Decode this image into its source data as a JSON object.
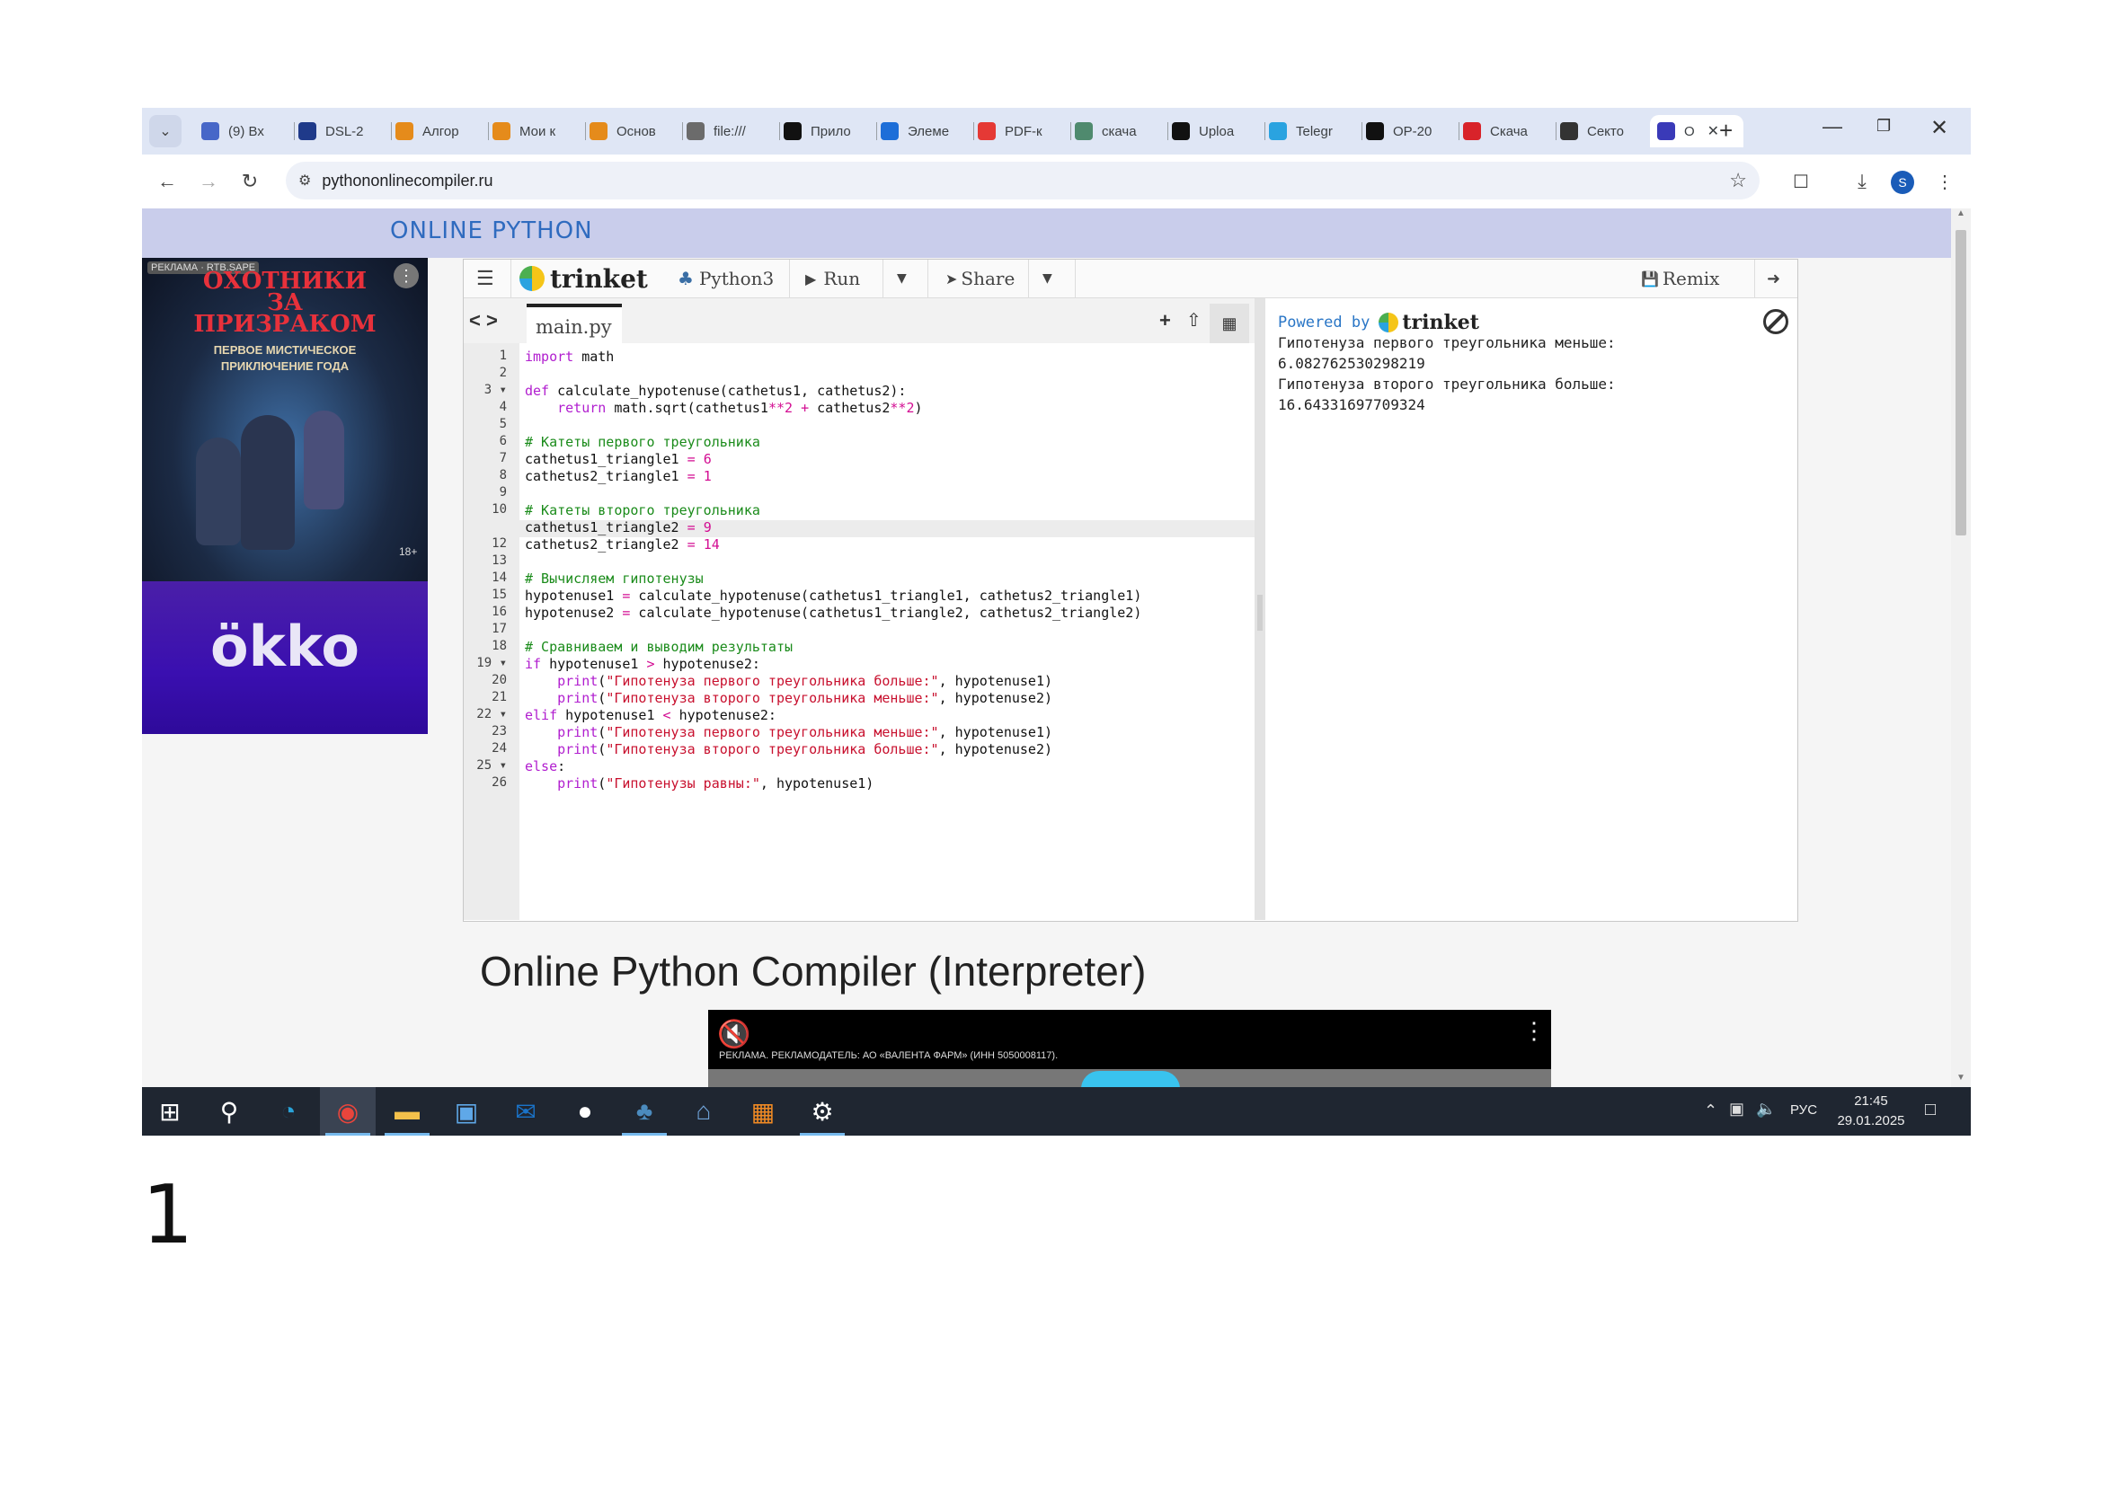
{
  "browser": {
    "tabs": [
      {
        "label": "(9) Вх",
        "icon": "mail-icon",
        "color": "#4767c8"
      },
      {
        "label": "DSL-2",
        "icon": "d-logo-icon",
        "color": "#1f3a8a"
      },
      {
        "label": "Алгор",
        "icon": "lyceum-icon",
        "color": "#e58b1b"
      },
      {
        "label": "Мои к",
        "icon": "lyceum-icon",
        "color": "#e58b1b"
      },
      {
        "label": "Основ",
        "icon": "lyceum-icon",
        "color": "#e58b1b"
      },
      {
        "label": "file:///",
        "icon": "globe-icon",
        "color": "#6b6b6b"
      },
      {
        "label": "Прило",
        "icon": "github-icon",
        "color": "#111111"
      },
      {
        "label": "Элеме",
        "icon": "cloud-icon",
        "color": "#1d6ed8"
      },
      {
        "label": "PDF-к",
        "icon": "pdf-grid-icon",
        "color": "#e53935"
      },
      {
        "label": "скача",
        "icon": "gamepad-icon",
        "color": "#4f8a6e"
      },
      {
        "label": "Uploa",
        "icon": "github-icon",
        "color": "#111111"
      },
      {
        "label": "Telegr",
        "icon": "telegram-icon",
        "color": "#2aa3e0"
      },
      {
        "label": "OP-20",
        "icon": "github-icon",
        "color": "#111111"
      },
      {
        "label": "Скача",
        "icon": "stop-icon",
        "color": "#d8232a"
      },
      {
        "label": "Секто",
        "icon": "power-icon",
        "color": "#333333"
      },
      {
        "label": "О",
        "icon": "site-icon",
        "color": "#3a3ab8"
      }
    ],
    "new_tab": "+",
    "url": "pythononlinecompiler.ru",
    "profile_initial": "S"
  },
  "site": {
    "name": "ONLINE PYTHON",
    "ad": {
      "label": "РЕКЛАМА · RTB.SAPE",
      "title_line1": "ОХОТНИКИ",
      "title_line2": "ЗА",
      "title_line3": "ПРИЗРАКОМ",
      "subtitle_line1": "ПЕРВОЕ МИСТИЧЕСКОЕ",
      "subtitle_line2": "ПРИКЛЮЧЕНИЕ ГОДА",
      "age": "18+",
      "brand": "ökko"
    },
    "page_title": "Online Python Compiler (Interpreter)",
    "video_ad_text": "РЕКЛАМА. РЕКЛАМОДАТЕЛЬ: АО «ВАЛЕНТА ФАРМ» (ИНН 5050008117)."
  },
  "trinket": {
    "brand": "trinket",
    "language": "Python3",
    "run": "Run",
    "share": "Share",
    "remix": "Remix",
    "file_tab": "main.py",
    "powered_by": "Powered by",
    "code_lines": [
      "import math",
      "",
      "def calculate_hypotenuse(cathetus1, cathetus2):",
      "    return math.sqrt(cathetus1**2 + cathetus2**2)",
      "",
      "# Катеты первого треугольника",
      "cathetus1_triangle1 = 6",
      "cathetus2_triangle1 = 1",
      "",
      "# Катеты второго треугольника",
      "cathetus1_triangle2 = 9",
      "cathetus2_triangle2 = 14",
      "",
      "# Вычисляем гипотенузы",
      "hypotenuse1 = calculate_hypotenuse(cathetus1_triangle1, cathetus2_triangle1)",
      "hypotenuse2 = calculate_hypotenuse(cathetus1_triangle2, cathetus2_triangle2)",
      "",
      "# Сравниваем и выводим результаты",
      "if hypotenuse1 > hypotenuse2:",
      "    print(\"Гипотенуза первого треугольника больше:\", hypotenuse1)",
      "    print(\"Гипотенуза второго треугольника меньше:\", hypotenuse2)",
      "elif hypotenuse1 < hypotenuse2:",
      "    print(\"Гипотенуза первого треугольника меньше:\", hypotenuse1)",
      "    print(\"Гипотенуза второго треугольника больше:\", hypotenuse2)",
      "else:",
      "    print(\"Гипотенузы равны:\", hypotenuse1)"
    ],
    "output_lines": [
      "Гипотенуза первого треугольника меньше:",
      "6.082762530298219",
      "Гипотенуза второго треугольника больше:",
      "16.64331697709324"
    ]
  },
  "taskbar": {
    "apps": [
      "windows-start-icon",
      "search-icon",
      "edge-icon",
      "chrome-icon",
      "file-explorer-icon",
      "store-icon",
      "outlook-icon",
      "github-desktop-icon",
      "python-icon",
      "network-app-icon",
      "office-icon",
      "settings-icon"
    ],
    "language": "РУС",
    "time": "21:45",
    "date": "29.01.2025"
  },
  "page_number": "1"
}
